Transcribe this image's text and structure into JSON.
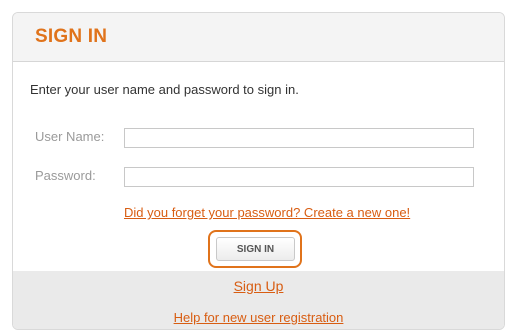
{
  "header": {
    "title": "SIGN IN"
  },
  "form": {
    "instructions": "Enter your user name and password to sign in.",
    "username_label": "User Name:",
    "username_value": "",
    "password_label": "Password:",
    "password_value": "",
    "forgot_link": "Did you forget your password? Create a new one!",
    "signin_button": "SIGN IN"
  },
  "footer": {
    "signup_link": "Sign Up",
    "help_link": "Help for new user registration"
  },
  "colors": {
    "accent": "#e0731b",
    "link": "#d85d12",
    "header_bg": "#f4f4f4",
    "footer_bg": "#eaeaea"
  }
}
